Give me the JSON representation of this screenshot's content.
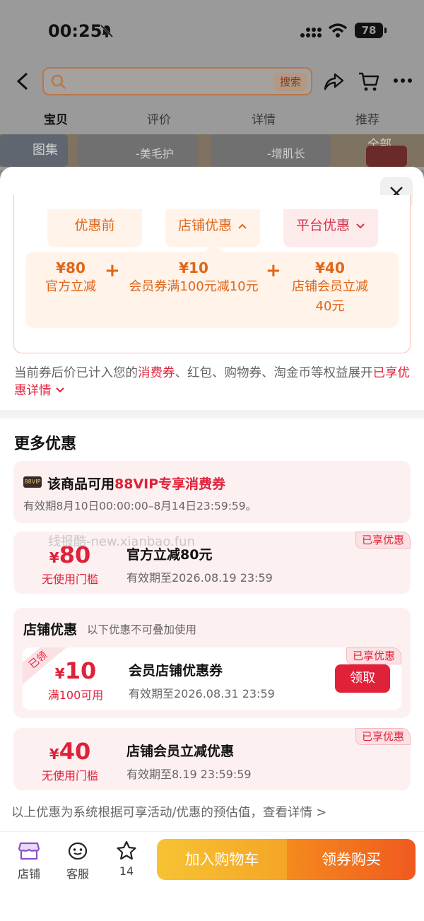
{
  "status": {
    "time": "00:25",
    "battery": "78"
  },
  "header": {
    "search_button": "搜索"
  },
  "tabs": [
    "宝贝",
    "评价",
    "详情",
    "推荐"
  ],
  "thumbs": {
    "gallery_label": "图集",
    "cap1": "-美毛护",
    "cap2": "-增肌长",
    "all_label": "全部"
  },
  "price": {
    "pills": [
      "优惠前",
      "店铺优惠",
      "平台优惠"
    ],
    "items": [
      {
        "amount": "¥80",
        "desc": "官方立减"
      },
      {
        "amount": "¥10",
        "desc": "会员券满100元减10元"
      },
      {
        "amount": "¥40",
        "desc": "店铺会员立减",
        "desc2": "40元"
      }
    ],
    "plus": "+"
  },
  "note": {
    "part1": "当前券后价已计入您的",
    "hl1": "消费券",
    "part2": "、红包、购物券、淘金币等权益展开",
    "hl2": "已享优惠详情"
  },
  "more": {
    "title": "更多优惠",
    "vip": {
      "badge": "88VIP",
      "title_pre": "该商品可用",
      "title_hl": "88VIP专享消费券",
      "valid": "有效期8月10日00:00:00–8月14日23:59:59。"
    },
    "watermark": "线报酷-new.xianbao.fun",
    "coupon1": {
      "badge": "已享优惠",
      "yen": "¥",
      "amount": "80",
      "condition": "无使用门槛",
      "title": "官方立减80元",
      "valid": "有效期至2026.08.19 23:59"
    },
    "store": {
      "title": "店铺优惠",
      "subtitle": "以下优惠不可叠加使用",
      "coupon": {
        "corner": "已领",
        "badge": "已享优惠",
        "yen": "¥",
        "amount": "10",
        "condition": "满100可用",
        "title": "会员店铺优惠券",
        "valid": "有效期至2026.08.31 23:59",
        "button": "领取"
      }
    },
    "coupon3": {
      "badge": "已享优惠",
      "yen": "¥",
      "amount": "40",
      "condition": "无使用门槛",
      "title": "店铺会员立减优惠",
      "valid": "有效期至8.19 23:59:59"
    },
    "disclaimer": "以上优惠为系统根据可享活动/优惠的预估值，查看详情 >"
  },
  "bottom": {
    "store": "店铺",
    "service": "客服",
    "fav_count": "14",
    "add_cart": "加入购物车",
    "buy": "领券购买"
  },
  "colors": {
    "accent_red": "#e0213a",
    "accent_orange": "#e06618",
    "cart_yellow": "#f5b92c",
    "buy_orange": "#f06a1f"
  }
}
